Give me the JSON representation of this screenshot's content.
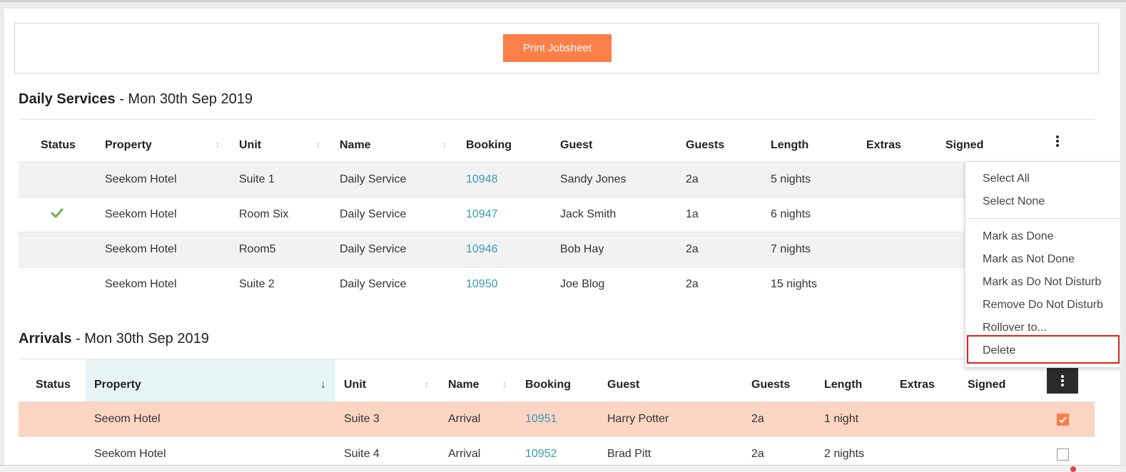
{
  "toolbar": {
    "print_label": "Print Jobsheet"
  },
  "daily": {
    "title_bold": "Daily Services",
    "title_rest": " - Mon 30th Sep 2019",
    "headers": [
      "Status",
      "Property",
      "Unit",
      "Name",
      "Booking",
      "Guest",
      "Guests",
      "Length",
      "Extras",
      "Signed"
    ],
    "rows": [
      {
        "status": "",
        "property": "Seekom Hotel",
        "unit": "Suite 1",
        "name": "Daily Service",
        "booking": "10948",
        "guest": "Sandy Jones",
        "guests": "2a",
        "length": "5 nights"
      },
      {
        "status": "done",
        "property": "Seekom Hotel",
        "unit": "Room Six",
        "name": "Daily Service",
        "booking": "10947",
        "guest": "Jack Smith",
        "guests": "1a",
        "length": "6 nights"
      },
      {
        "status": "",
        "property": "Seekom Hotel",
        "unit": "Room5",
        "name": "Daily Service",
        "booking": "10946",
        "guest": "Bob Hay",
        "guests": "2a",
        "length": "7 nights"
      },
      {
        "status": "",
        "property": "Seekom Hotel",
        "unit": "Suite 2",
        "name": "Daily Service",
        "booking": "10950",
        "guest": "Joe Blog",
        "guests": "2a",
        "length": "15 nights"
      }
    ]
  },
  "arrivals": {
    "title_bold": "Arrivals",
    "title_rest": " - Mon 30th Sep 2019",
    "headers": [
      "Status",
      "Property",
      "Unit",
      "Name",
      "Booking",
      "Guest",
      "Guests",
      "Length",
      "Extras",
      "Signed"
    ],
    "rows": [
      {
        "property": "Seeom Hotel",
        "unit": "Suite 3",
        "name": "Arrival",
        "booking": "10951",
        "guest": "Harry Potter",
        "guests": "2a",
        "length": "1 night",
        "checked": true
      },
      {
        "property": "Seekom Hotel",
        "unit": "Suite 4",
        "name": "Arrival",
        "booking": "10952",
        "guest": "Brad Pitt",
        "guests": "2a",
        "length": "2 nights",
        "checked": false
      }
    ]
  },
  "menu": {
    "items": [
      "Select All",
      "Select None",
      "Mark as Done",
      "Mark as Not Done",
      "Mark as Do Not Disturb",
      "Remove Do Not Disturb",
      "Rollover to...",
      "Delete"
    ]
  },
  "colors": {
    "accent": "#fb7f48",
    "link": "#3a9ab6",
    "done": "#6ab04c",
    "highlight_row": "#fdd5c3",
    "selected_header": "#e6f4f6",
    "delete_outline": "#e0201b"
  }
}
